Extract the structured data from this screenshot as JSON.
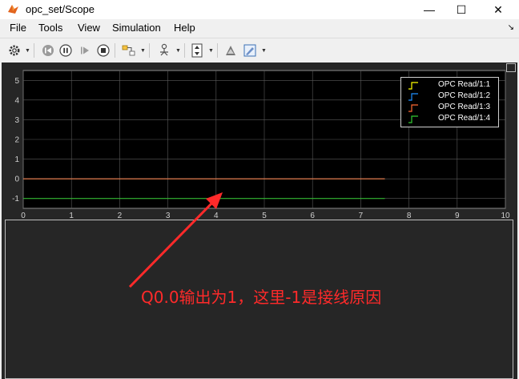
{
  "window": {
    "title": "opc_set/Scope",
    "minimize_glyph": "—",
    "maximize_glyph": "☐",
    "close_glyph": "✕"
  },
  "menu": {
    "items": [
      {
        "label": "File",
        "accel": "F"
      },
      {
        "label": "Tools",
        "accel": "T"
      },
      {
        "label": "View",
        "accel": "V"
      },
      {
        "label": "Simulation",
        "accel": "i"
      },
      {
        "label": "Help",
        "accel": "H"
      }
    ],
    "dock_glyph": "↘"
  },
  "toolbar": {
    "buttons": [
      {
        "name": "settings-gear-icon"
      },
      {
        "name": "step-back-icon"
      },
      {
        "name": "pause-icon"
      },
      {
        "name": "step-forward-icon"
      },
      {
        "name": "stop-icon"
      },
      {
        "name": "highlight-block-icon"
      },
      {
        "name": "triggers-icon"
      },
      {
        "name": "autoscale-icon"
      },
      {
        "name": "measurements-icon"
      },
      {
        "name": "style-icon"
      }
    ]
  },
  "chart_data": {
    "type": "line",
    "title": "",
    "xlabel": "",
    "ylabel": "",
    "xlim": [
      0,
      10
    ],
    "ylim": [
      -1.5,
      5.5
    ],
    "x_ticks": [
      "0",
      "1",
      "2",
      "3",
      "4",
      "5",
      "6",
      "7",
      "8",
      "9",
      "10"
    ],
    "y_ticks": [
      "-1",
      "0",
      "1",
      "2",
      "3",
      "4",
      "5"
    ],
    "grid": true,
    "legend_placement": "top-right",
    "series": [
      {
        "name": "OPC Read/1:1",
        "color": "#ffff00",
        "x": [
          0,
          7.5
        ],
        "y": [
          0,
          0
        ]
      },
      {
        "name": "OPC Read/1:2",
        "color": "#1f8fff",
        "x": [
          0,
          7.5
        ],
        "y": [
          0,
          0
        ]
      },
      {
        "name": "OPC Read/1:3",
        "color": "#ff6a33",
        "x": [
          0,
          7.5
        ],
        "y": [
          0,
          0
        ]
      },
      {
        "name": "OPC Read/1:4",
        "color": "#33cc33",
        "x": [
          0,
          7.5
        ],
        "y": [
          -1,
          -1
        ]
      }
    ]
  },
  "annotation": {
    "text": "Q0.0输出为1，这里-1是接线原因",
    "color": "#ff2a2a"
  },
  "colors": {
    "plot_background": "#000000",
    "scope_background": "#262626",
    "grid": "#5a5a5a",
    "axis_text": "#cfcfcf"
  }
}
